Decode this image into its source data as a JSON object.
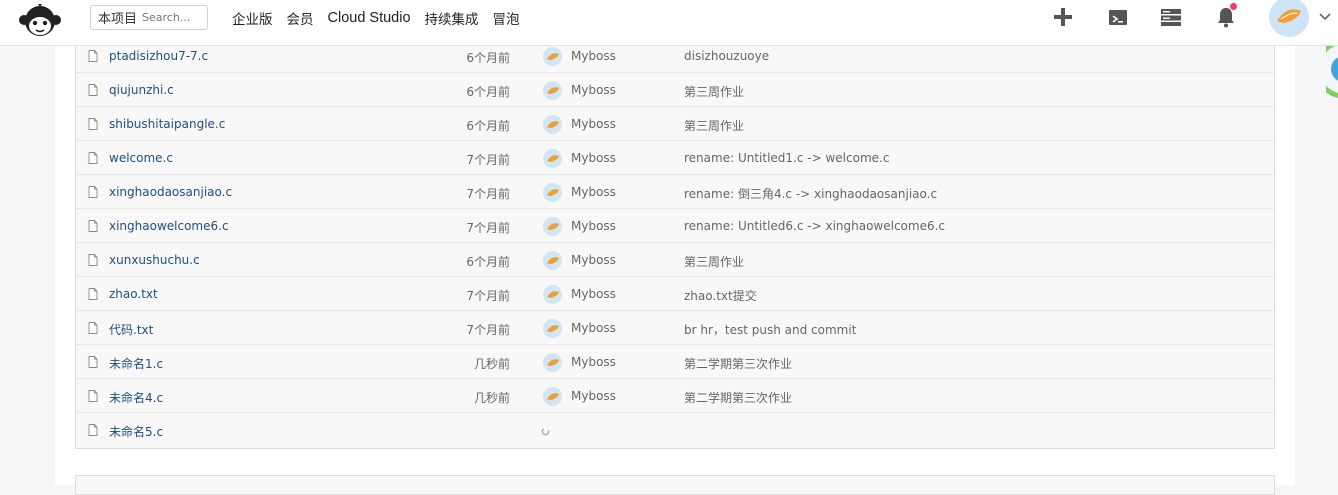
{
  "header": {
    "search": {
      "scope_label": "本项目",
      "placeholder": "Search..."
    },
    "nav": [
      {
        "label": "企业版"
      },
      {
        "label": "会员"
      },
      {
        "label": "Cloud Studio"
      },
      {
        "label": "持续集成"
      },
      {
        "label": "冒泡"
      }
    ],
    "icons": [
      "plus-icon",
      "terminal-icon",
      "server-icon",
      "bell-icon",
      "avatar",
      "chevron-down-icon"
    ],
    "notification_dot_color": "#f23c6a"
  },
  "files": [
    {
      "name": "ptadisizhou7-7.c",
      "time": "6个月前",
      "user": "Myboss",
      "message": "disizhouzuoye"
    },
    {
      "name": "qiujunzhi.c",
      "time": "6个月前",
      "user": "Myboss",
      "message": "第三周作业"
    },
    {
      "name": "shibushitaipangle.c",
      "time": "6个月前",
      "user": "Myboss",
      "message": "第三周作业"
    },
    {
      "name": "welcome.c",
      "time": "7个月前",
      "user": "Myboss",
      "message": "rename: Untitled1.c -> welcome.c"
    },
    {
      "name": "xinghaodaosanjiao.c",
      "time": "7个月前",
      "user": "Myboss",
      "message": "rename: 倒三角4.c -> xinghaodaosanjiao.c"
    },
    {
      "name": "xinghaowelcome6.c",
      "time": "7个月前",
      "user": "Myboss",
      "message": "rename: Untitled6.c -> xinghaowelcome6.c"
    },
    {
      "name": "xunxushuchu.c",
      "time": "6个月前",
      "user": "Myboss",
      "message": "第三周作业"
    },
    {
      "name": "zhao.txt",
      "time": "7个月前",
      "user": "Myboss",
      "message": "zhao.txt提交"
    },
    {
      "name": "代码.txt",
      "time": "7个月前",
      "user": "Myboss",
      "message": "br hr，test push and commit"
    },
    {
      "name": "未命名1.c",
      "time": "几秒前",
      "user": "Myboss",
      "message": "第二学期第三次作业"
    },
    {
      "name": "未命名4.c",
      "time": "几秒前",
      "user": "Myboss",
      "message": "第二学期第三次作业"
    },
    {
      "name": "未命名5.c",
      "time": "",
      "user": "",
      "message": "",
      "loading": true
    }
  ],
  "colors": {
    "link": "#1e4e80",
    "avatar_bg": "#cfe6f5",
    "avatar_mark": "#f0a030"
  }
}
